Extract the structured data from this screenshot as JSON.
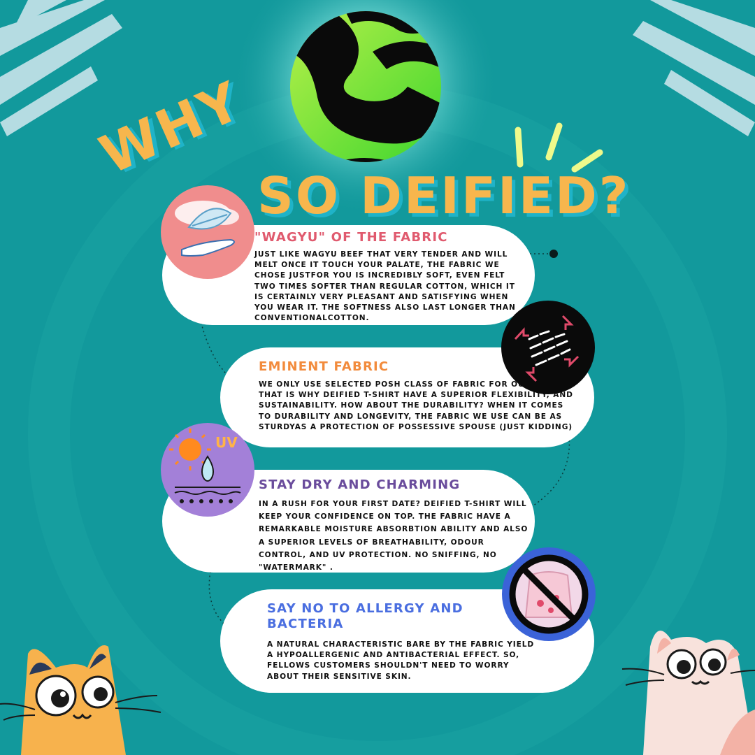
{
  "title": {
    "why": "WHY",
    "rest": "SO DEIFIED?"
  },
  "sections": [
    {
      "heading": "\"WAGYU\" OF THE FABRIC",
      "color": "#e05a6e",
      "text": "JUST LIKE WAGYU BEEF THAT VERY TENDER AND WILL MELT ONCE IT TOUCH YOUR PALATE, THE FABRIC WE CHOSE JUSTFOR YOU IS INCREDIBLY SOFT, EVEN FELT TWO TIMES SOFTER THAN REGULAR COTTON, WHICH IT IS CERTAINLY VERY PLEASANT AND SATISFYING WHEN YOU WEAR IT. THE SOFTNESS ALSO LAST LONGER THAN CONVENTIONALCOTTON."
    },
    {
      "heading": "EMINENT FABRIC",
      "color": "#f28b3c",
      "text": "WE ONLY USE SELECTED POSH CLASS OF FABRIC FOR OUR T-SHIRT. THAT IS WHY DEIFIED T-SHIRT HAVE A SUPERIOR FLEXIBILITY, AND SUSTAINABILITY. HOW ABOUT THE DURABILITY? WHEN IT COMES TO DURABILITY AND LONGEVITY, THE FABRIC WE USE CAN BE AS STURDYAS A PROTECTION OF POSSESSIVE SPOUSE (JUST KIDDING)"
    },
    {
      "heading": "STAY DRY AND CHARMING",
      "color": "#6a4c9c",
      "text": "IN A RUSH FOR YOUR FIRST DATE? DEIFIED T-SHIRT WILL KEEP YOUR CONFIDENCE ON TOP. THE FABRIC HAVE A REMARKABLE MOISTURE ABSORBTION ABILITY AND ALSO A SUPERIOR LEVELS OF BREATHABILITY, ODOUR CONTROL, AND UV PROTECTION. NO SNIFFING, NO \"WATERMARK\" ."
    },
    {
      "heading": "SAY NO TO ALLERGY AND BACTERIA",
      "color": "#4a6ee0",
      "text": "A NATURAL CHARACTERISTIC BARE BY THE FABRIC YIELD A HYPOALLERGENIC AND ANTIBACTERIAL EFFECT. SO, FELLOWS CUSTOMERS SHOULDN'T NEED TO WORRY ABOUT THEIR SENSITIVE SKIN."
    }
  ],
  "icons": {
    "uv_label": "UV"
  },
  "colors": {
    "background": "#12999c",
    "title": "#f7b64d",
    "title_shadow": "#1fb3c8",
    "logo_green": "#7de83c"
  }
}
